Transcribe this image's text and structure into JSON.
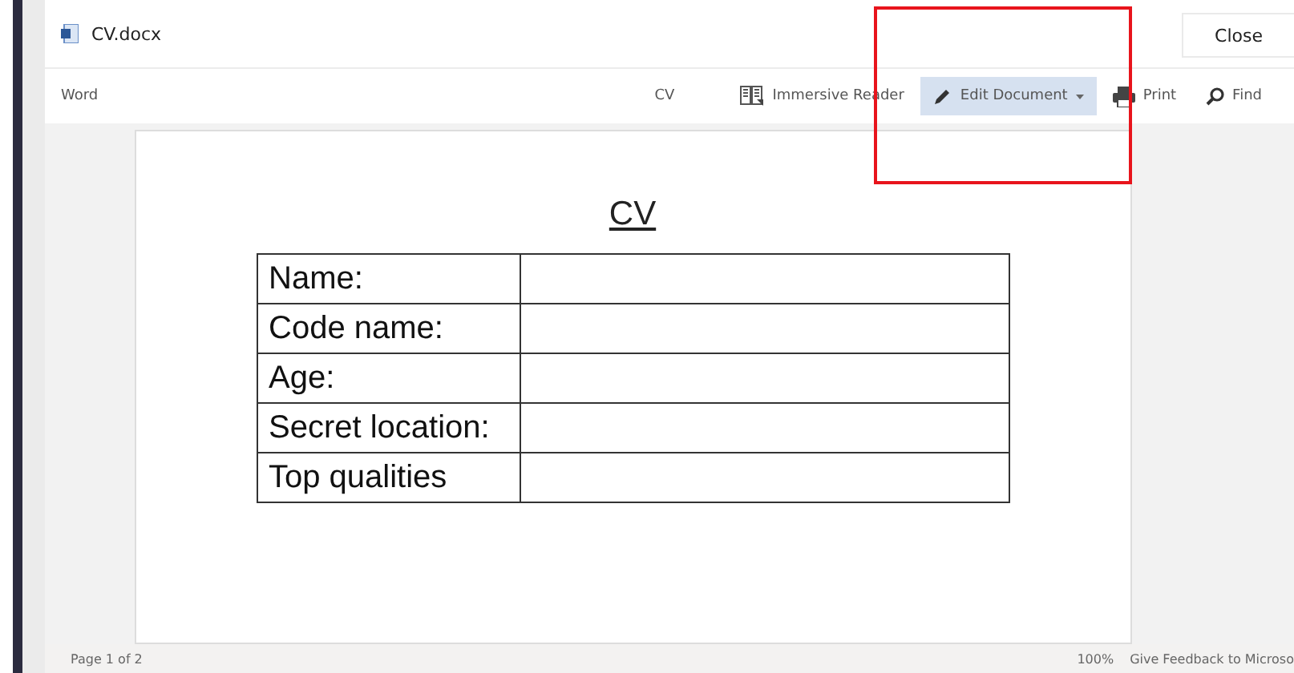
{
  "window": {
    "title": "CV.docx",
    "close_button": "Close"
  },
  "toolbar": {
    "app_name": "Word",
    "doc_name": "CV",
    "items": [
      {
        "kind": "reader",
        "label": "Immersive Reader",
        "selected": false
      },
      {
        "kind": "edit",
        "label": "Edit Document",
        "selected": true
      },
      {
        "kind": "print",
        "label": "Print",
        "selected": false
      },
      {
        "kind": "find",
        "label": "Find",
        "selected": false
      }
    ]
  },
  "document": {
    "heading": "CV",
    "rows": [
      {
        "label": "Name:"
      },
      {
        "label": "Code name:"
      },
      {
        "label": "Age:"
      },
      {
        "label": "Secret location:"
      },
      {
        "label": "Top qualities"
      }
    ]
  },
  "status_bar": {
    "page": "Page 1 of 2",
    "zoom": "100%",
    "feedback": "Give Feedback to Microso"
  }
}
